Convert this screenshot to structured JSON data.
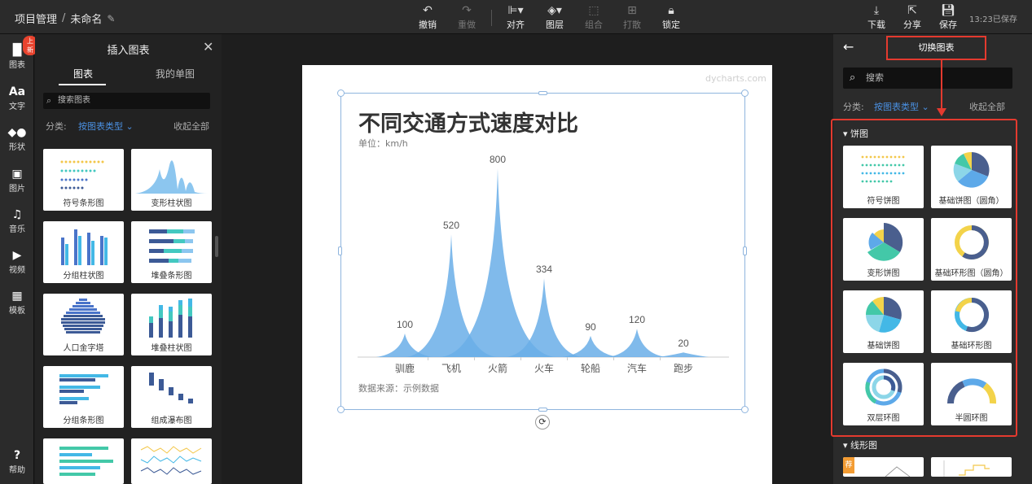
{
  "breadcrumb": {
    "root": "项目管理",
    "sep": "/",
    "name": "未命名"
  },
  "toolbar": {
    "undo": "撤销",
    "redo": "重做",
    "align": "对齐",
    "layer": "图层",
    "group": "组合",
    "ungroup": "打散",
    "lock": "锁定",
    "download": "下载",
    "share": "分享",
    "save": "保存",
    "save_status": "13:23已保存"
  },
  "leftnav": {
    "badge": "上新",
    "items": [
      "图表",
      "文字",
      "形状",
      "图片",
      "音乐",
      "视频",
      "模板"
    ],
    "help": "帮助",
    "text_icon": "Aa"
  },
  "leftpanel": {
    "title": "插入图表",
    "tabs": [
      "图表",
      "我的单图"
    ],
    "search_placeholder": "搜索图表",
    "filter_label": "分类:",
    "filter_value": "按图表类型",
    "collapse": "收起全部",
    "cards": [
      "符号条形图",
      "变形柱状图",
      "分组柱状图",
      "堆叠条形图",
      "人口金字塔",
      "堆叠柱状图",
      "分组条形图",
      "组成瀑布图"
    ]
  },
  "canvas": {
    "watermark": "dycharts.com"
  },
  "chart_data": {
    "type": "area",
    "title": "不同交通方式速度对比",
    "unit": "单位：km/h",
    "source": "数据来源：示例数据",
    "categories": [
      "驯鹿",
      "飞机",
      "火箭",
      "火车",
      "轮船",
      "汽车",
      "跑步"
    ],
    "values": [
      100,
      520,
      800,
      334,
      90,
      120,
      20
    ],
    "color": "#6aaee8",
    "grid": false
  },
  "rightpanel": {
    "title": "切换图表",
    "search_placeholder": "搜索",
    "filter_label": "分类:",
    "filter_value": "按图表类型",
    "collapse": "收起全部",
    "section_pie": "饼图",
    "section_line": "线形图",
    "cards": [
      "符号饼图",
      "基础饼图（圆角）",
      "变形饼图",
      "基础环形图（圆角）",
      "基础饼图",
      "基础环形图",
      "双层环图",
      "半圆环图"
    ],
    "line_card_tag": "荐"
  },
  "colors": {
    "accent_red": "#e43a2f",
    "link_blue": "#4a90e2",
    "chart_blue": "#6aaee8"
  }
}
